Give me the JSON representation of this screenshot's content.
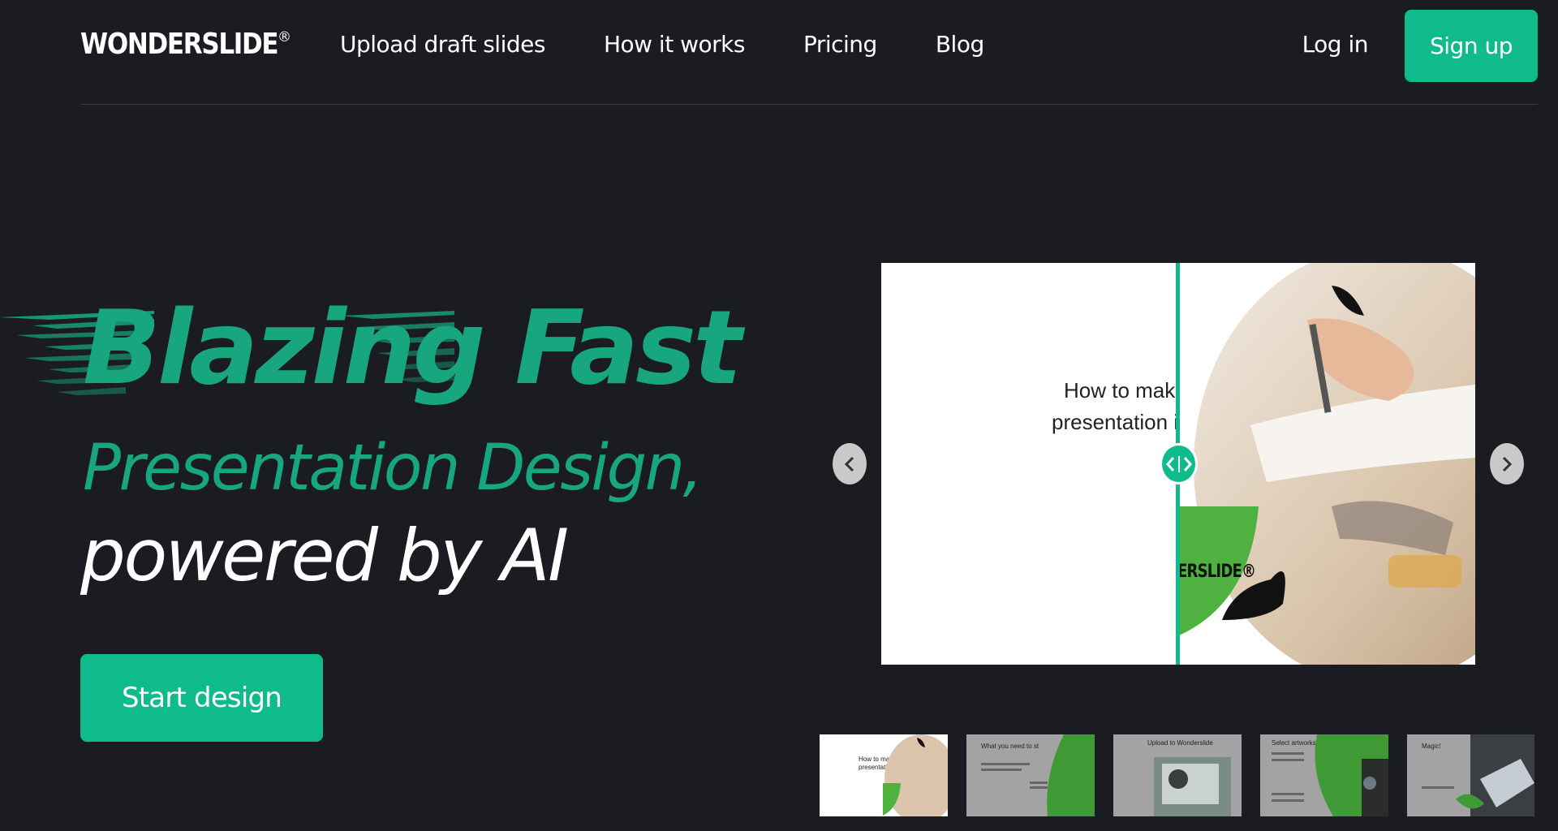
{
  "header": {
    "logo": "WONDERSLIDE",
    "logo_mark": "®",
    "nav": [
      "Upload draft slides",
      "How it works",
      "Pricing",
      "Blog"
    ],
    "login": "Log in",
    "signup": "Sign up"
  },
  "hero": {
    "line1": "Blazing Fast",
    "line2": "Presentation Design,",
    "line3": "powered by AI",
    "cta": "Start design"
  },
  "viewer": {
    "slide_title_1": "How to mak",
    "slide_title_2": "presentation i",
    "after_brand": "ERSLIDE®",
    "prev_icon": "chevron-left-icon",
    "next_icon": "chevron-right-icon",
    "handle_icon": "compare-arrows-icon"
  },
  "thumbnails": [
    {
      "text": "How to mak\npresentation"
    },
    {
      "text": "What you need to st"
    },
    {
      "text": "Upload to Wonderslide"
    },
    {
      "text": "Select artworks"
    },
    {
      "text": "Magic!"
    }
  ],
  "colors": {
    "background": "#1b1c21",
    "accent": "#0fbb8a",
    "hero_green": "#17a67d"
  }
}
